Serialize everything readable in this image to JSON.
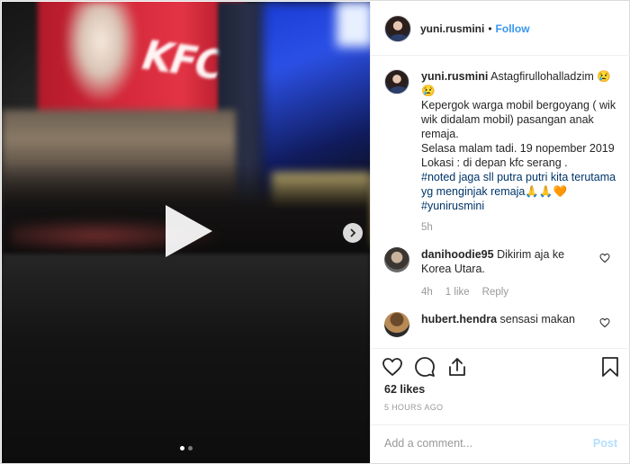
{
  "header": {
    "username": "yuni.rusmini",
    "separator": "•",
    "follow_label": "Follow"
  },
  "caption": {
    "username": "yuni.rusmini",
    "line1": "Astagfirullohalladzim 😢😢",
    "line2": "Kepergok warga mobil bergoyang ( wik wik didalam mobil) pasangan anak remaja.",
    "line3": "Selasa malam tadi. 19 nopember 2019",
    "line4": "Lokasi : di depan kfc serang .",
    "line5": "#noted jaga sll putra putri kita terutama yg menginjak remaja🙏🙏🧡",
    "hashtag": "#yunirusmini",
    "age": "5h"
  },
  "comments": [
    {
      "username": "danihoodie95",
      "text": "Dikirim aja ke Korea Utara.",
      "age": "4h",
      "likes": "1 like",
      "reply_label": "Reply"
    },
    {
      "username": "hubert.hendra",
      "text": "sensasi makan"
    }
  ],
  "actions": {
    "likes": "62 likes",
    "time": "5 HOURS AGO",
    "comment_placeholder": "Add a comment...",
    "post_label": "Post"
  },
  "media": {
    "sign_text": "KFC",
    "carousel_total": 2,
    "carousel_active": 1
  },
  "colors": {
    "link_blue": "#3897f0",
    "post_disabled": "#b2dffc",
    "muted": "#999999"
  }
}
